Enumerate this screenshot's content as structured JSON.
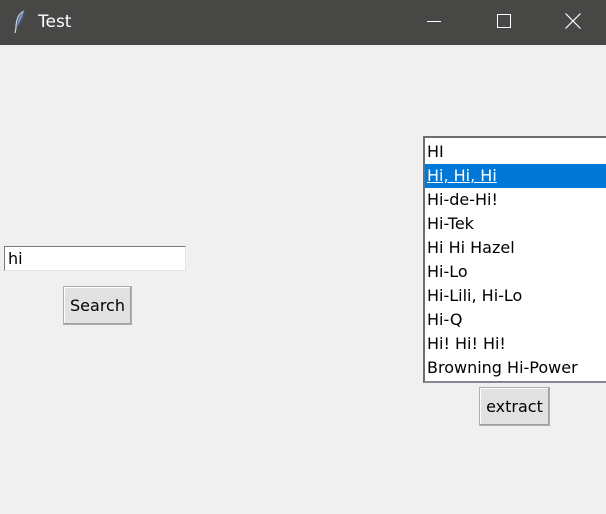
{
  "window": {
    "title": "Test",
    "controls": {
      "minimize_icon": "minimize-icon",
      "maximize_icon": "maximize-icon",
      "close_icon": "close-icon"
    },
    "app_icon": "feather-icon"
  },
  "search": {
    "input_value": "hi",
    "button_label": "Search"
  },
  "results": {
    "items": [
      "HI",
      "Hi, Hi, Hi",
      "Hi-de-Hi!",
      "Hi-Tek",
      "Hi Hi Hazel",
      "Hi-Lo",
      "Hi-Lili, Hi-Lo",
      "Hi-Q",
      "Hi! Hi! Hi!",
      "Browning Hi-Power"
    ],
    "selected_index": 1,
    "extract_label": "extract"
  },
  "colors": {
    "titlebar": "#474745",
    "background": "#f0f0f0",
    "selection": "#0078d7"
  }
}
